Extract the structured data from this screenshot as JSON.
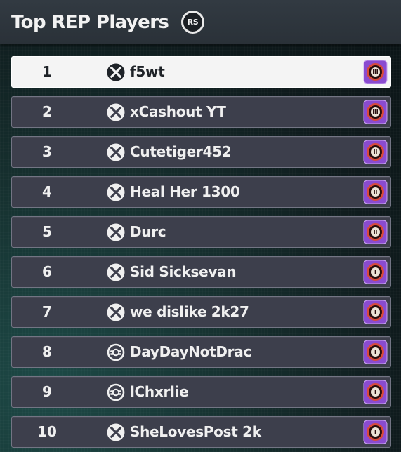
{
  "header": {
    "title": "Top REP Players",
    "badge": "RS"
  },
  "colors": {
    "row_background": "#3d3f4c",
    "row_border": "#737584",
    "highlight_row": "#f4f4f4",
    "badge_purple": "#8a4bd0",
    "badge_red_ring": "#c0392b"
  },
  "players": [
    {
      "rank": "1",
      "name": "f5wt",
      "platform": "xbox-icon",
      "rep_badge": "rep-badge-tier-3",
      "highlighted": true
    },
    {
      "rank": "2",
      "name": "xCashout YT",
      "platform": "xbox-icon",
      "rep_badge": "rep-badge-tier-3"
    },
    {
      "rank": "3",
      "name": "Cutetiger452",
      "platform": "xbox-icon",
      "rep_badge": "rep-badge-tier-2"
    },
    {
      "rank": "4",
      "name": "Heal Her 1300",
      "platform": "xbox-icon",
      "rep_badge": "rep-badge-tier-2"
    },
    {
      "rank": "5",
      "name": "Durc",
      "platform": "xbox-icon",
      "rep_badge": "rep-badge-tier-2"
    },
    {
      "rank": "6",
      "name": "Sid Sicksevan",
      "platform": "xbox-icon",
      "rep_badge": "rep-badge-tier-1"
    },
    {
      "rank": "7",
      "name": "we dislike 2k27",
      "platform": "xbox-icon",
      "rep_badge": "rep-badge-tier-1"
    },
    {
      "rank": "8",
      "name": "DayDayNotDrac",
      "platform": "crossplay-icon",
      "rep_badge": "rep-badge-tier-1"
    },
    {
      "rank": "9",
      "name": "lChxrlie",
      "platform": "crossplay-icon",
      "rep_badge": "rep-badge-tier-1"
    },
    {
      "rank": "10",
      "name": "SheLovesPost 2k",
      "platform": "xbox-icon",
      "rep_badge": "rep-badge-tier-1"
    }
  ]
}
